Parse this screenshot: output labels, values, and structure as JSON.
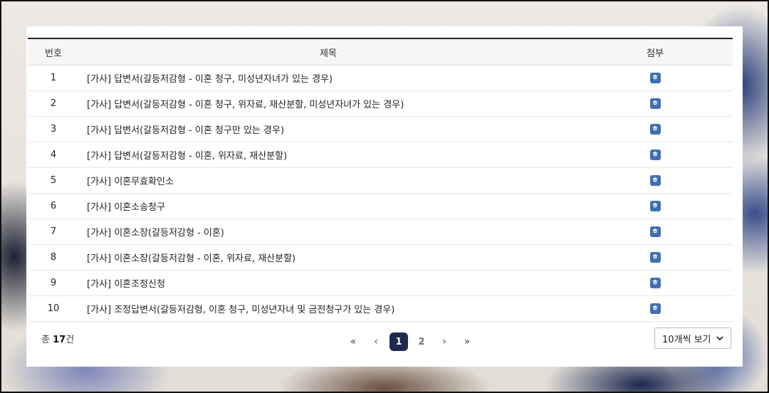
{
  "table": {
    "headers": {
      "number": "번호",
      "title": "제목",
      "attachment": "첨부"
    },
    "rows": [
      {
        "number": "1",
        "title": "[가사] 답변서(갈등저감형 - 이혼 청구, 미성년자녀가 있는 경우)",
        "attachment_icon": "hwp-file-icon"
      },
      {
        "number": "2",
        "title": "[가사] 답변서(갈등저감형 - 이혼 청구, 위자료, 재산분할, 미성년자녀가 있는 경우)",
        "attachment_icon": "hwp-file-icon"
      },
      {
        "number": "3",
        "title": "[가사] 답변서(갈등저감형 - 이혼 청구만 있는 경우)",
        "attachment_icon": "hwp-file-icon"
      },
      {
        "number": "4",
        "title": "[가사] 답변서(갈등저감형 - 이혼, 위자료, 재산분할)",
        "attachment_icon": "hwp-file-icon"
      },
      {
        "number": "5",
        "title": "[가사] 이혼무효확인소",
        "attachment_icon": "hwp-file-icon"
      },
      {
        "number": "6",
        "title": "[가사] 이혼소송청구",
        "attachment_icon": "hwp-file-icon"
      },
      {
        "number": "7",
        "title": "[가사] 이혼소장(갈등저감형 - 이혼)",
        "attachment_icon": "hwp-file-icon"
      },
      {
        "number": "8",
        "title": "[가사] 이혼소장(갈등저감형 - 이혼, 위자료, 재산분할)",
        "attachment_icon": "hwp-file-icon"
      },
      {
        "number": "9",
        "title": "[가사] 이혼조정신청",
        "attachment_icon": "hwp-file-icon"
      },
      {
        "number": "10",
        "title": "[가사] 조정답변서(갈등저감형, 이혼 청구, 미성년자녀 및 금전청구가 있는 경우)",
        "attachment_icon": "hwp-file-icon"
      }
    ],
    "attachment_glyph": "ㅎ"
  },
  "footer": {
    "total_prefix": "총 ",
    "total_count": "17",
    "total_suffix": "건",
    "pagination": {
      "first": "«",
      "prev": "‹",
      "pages": [
        "1",
        "2"
      ],
      "current": "1",
      "next": "›",
      "last": "»"
    },
    "page_size_select": {
      "value": "10개씩 보기",
      "icon": "chevron-down-icon"
    }
  },
  "colors": {
    "accent": "#1f2a4d",
    "attachment_icon": "#3f6fb0"
  }
}
